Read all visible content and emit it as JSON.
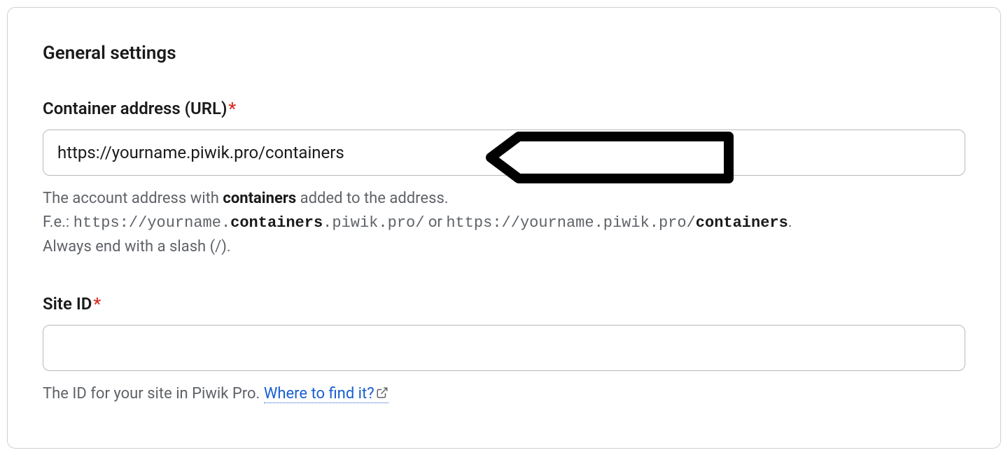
{
  "section": {
    "title": "General settings"
  },
  "fields": {
    "container_url": {
      "label": "Container address (URL)",
      "required_mark": "*",
      "value": "https://yourname.piwik.pro/containers",
      "help_prefix": "The account address with ",
      "help_bold": "containers",
      "help_suffix": " added to the address.",
      "help_example_prefix": "F.e.: ",
      "help_example_1a": "https://yourname.",
      "help_example_1b": "containers",
      "help_example_1c": ".piwik.pro/",
      "help_or": " or ",
      "help_example_2a": "https://yourname.piwik.pro/",
      "help_example_2b": "containers",
      "help_example_2c": ".",
      "help_slash": "Always end with a slash (/)."
    },
    "site_id": {
      "label": "Site ID",
      "required_mark": "*",
      "value": "",
      "help_prefix": "The ID for your site in Piwik Pro. ",
      "help_link_text": "Where to find it?"
    }
  }
}
